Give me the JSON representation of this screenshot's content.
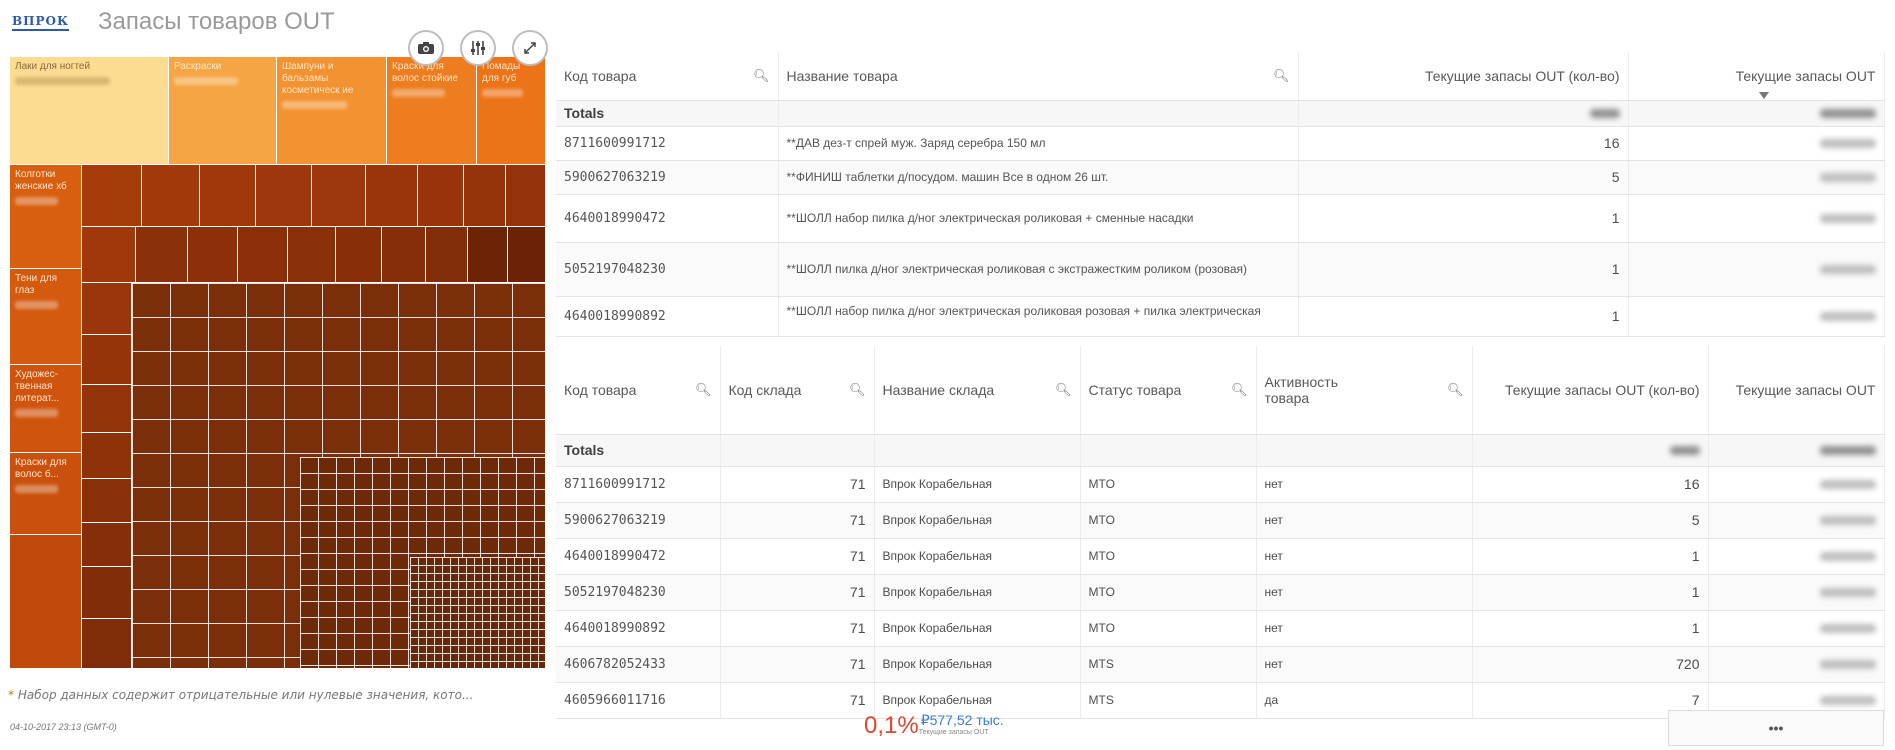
{
  "header": {
    "logo": "ВПРОК",
    "title": "Запасы товаров OUT"
  },
  "toolbar": {
    "snapshot_icon": "camera-icon",
    "settings_icon": "sliders-icon",
    "expand_icon": "expand-icon"
  },
  "treemap": {
    "top_labels": [
      "Лаки для ногтей",
      "Раскраски",
      "Шампуни и бальзамы косметическ ие",
      "Краски для волос стойкие",
      "Помады для губ"
    ],
    "left_labels": [
      "Колготки женские хб",
      "Тени для глаз",
      "Художес- твенная литерат...",
      "Краски для волос б..."
    ]
  },
  "footnote": {
    "mark": "*",
    "text": "Набор данных содержит отрицательные или нулевые значения, кото..."
  },
  "timestamp": "04-10-2017 23:13 (GMT-0)",
  "table1": {
    "headers": [
      "Код товара",
      "Название товара",
      "Текущие запасы OUT (кол-во)",
      "Текущие запасы OUT"
    ],
    "totals_label": "Totals",
    "rows": [
      {
        "code": "8711600991712",
        "name": "**ДАВ дез-т спрей муж. Заряд серебра 150 мл",
        "qty": "16"
      },
      {
        "code": "5900627063219",
        "name": "**ФИНИШ таблетки д/посудом. машин Все в одном 26 шт.",
        "qty": "5"
      },
      {
        "code": "4640018990472",
        "name": "**ШОЛЛ набор пилка д/ног электрическая роликовая + сменные насадки",
        "qty": "1"
      },
      {
        "code": "5052197048230",
        "name": "**ШОЛЛ пилка д/ног электрическая роликовая с экстражестким роликом (розовая)",
        "qty": "1"
      },
      {
        "code": "4640018990892",
        "name": "**ШОЛЛ набор пилка д/ног электрическая роликовая розовая + пилка электрическая",
        "qty": "1"
      }
    ]
  },
  "table2": {
    "headers": [
      "Код товара",
      "Код склада",
      "Название склада",
      "Статус товара",
      "Активность товара",
      "Текущие запасы OUT (кол-во)",
      "Текущие запасы OUT"
    ],
    "totals_label": "Totals",
    "rows": [
      {
        "code": "8711600991712",
        "store": "71",
        "store_name": "Впрок Корабельная",
        "status": "MTO",
        "active": "нет",
        "qty": "16"
      },
      {
        "code": "5900627063219",
        "store": "71",
        "store_name": "Впрок Корабельная",
        "status": "MTO",
        "active": "нет",
        "qty": "5"
      },
      {
        "code": "4640018990472",
        "store": "71",
        "store_name": "Впрок Корабельная",
        "status": "MTO",
        "active": "нет",
        "qty": "1"
      },
      {
        "code": "5052197048230",
        "store": "71",
        "store_name": "Впрок Корабельная",
        "status": "MTO",
        "active": "нет",
        "qty": "1"
      },
      {
        "code": "4640018990892",
        "store": "71",
        "store_name": "Впрок Корабельная",
        "status": "MTO",
        "active": "нет",
        "qty": "1"
      },
      {
        "code": "4606782052433",
        "store": "71",
        "store_name": "Впрок Корабельная",
        "status": "MTS",
        "active": "нет",
        "qty": "720"
      },
      {
        "code": "4605966011716",
        "store": "71",
        "store_name": "Впрок Корабельная",
        "status": "MTS",
        "active": "да",
        "qty": "7"
      }
    ]
  },
  "kpi": {
    "percent": "0,1%",
    "value": "₽577,52 тыс.",
    "label": "Текущие запасы OUT"
  },
  "more_button": {
    "label": "•••"
  },
  "colors": {
    "accent_blue": "#2b5aa8",
    "kpi_red": "#e0462e",
    "treemap_light": "#fbdc92",
    "treemap_dark": "#7a2f0a"
  }
}
